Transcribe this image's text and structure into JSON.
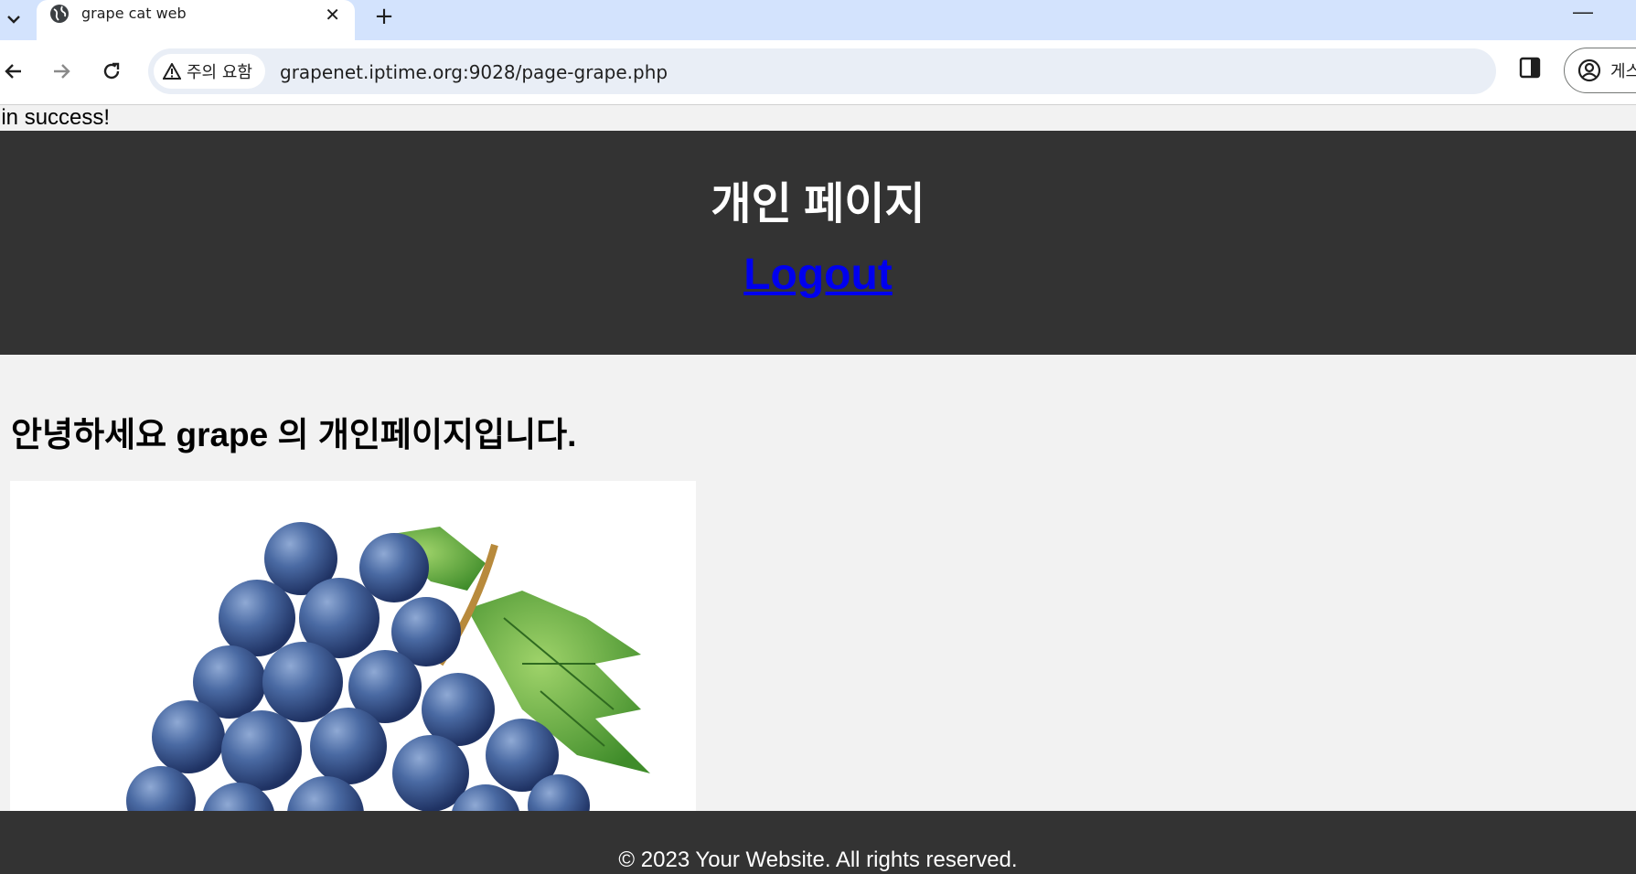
{
  "browser": {
    "tab_title": "grape cat web",
    "tab_close": "✕",
    "new_tab": "+",
    "minimize": "—",
    "security_label": "주의 요함",
    "url": "grapenet.iptime.org:9028/page-grape.php",
    "profile_label": "게스"
  },
  "page": {
    "status_message": "gin success!",
    "header_title": "개인 페이지",
    "logout_label": "Logout",
    "greeting": "안녕하세요 grape 의 개인페이지입니다.",
    "footer": "© 2023 Your Website. All rights reserved."
  },
  "colors": {
    "header_bg": "#333333",
    "page_bg": "#f2f2f2",
    "link": "#0000ee",
    "tabbar_bg": "#d3e3fd",
    "grape": "#3f5f95",
    "leaf": "#5aa63a"
  },
  "icons": [
    "chevron-down-icon",
    "globe-icon",
    "close-icon",
    "plus-icon",
    "back-arrow-icon",
    "forward-arrow-icon",
    "reload-icon",
    "warning-icon",
    "side-panel-icon",
    "profile-icon"
  ]
}
